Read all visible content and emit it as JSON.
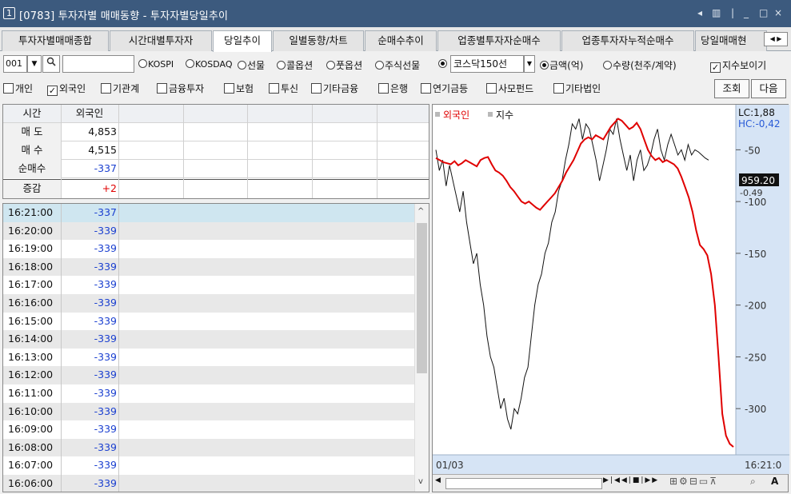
{
  "window": {
    "num": "1",
    "title": "[0783] 투자자별 매매동향 - 투자자별당일추이",
    "controls": [
      "◂",
      "▥",
      "|",
      "_",
      "□",
      "×"
    ]
  },
  "tabs": [
    "투자자별매매종합",
    "시간대별투자자",
    "당일추이",
    "일별동향/차트",
    "순매수추이",
    "업종별투자자순매수",
    "업종투자자누적순매수",
    "당일매매현"
  ],
  "active_tab": 2,
  "toolbar": {
    "code": "001",
    "search_value": "",
    "market_options": [
      "KOSPI",
      "KOSDAQ",
      "선물",
      "콜옵션",
      "풋옵션",
      "주식선물"
    ],
    "selected_market": "코스닥150선",
    "unit_options": [
      "금액(억)",
      "수량(천주/계약)"
    ],
    "selected_unit": 0,
    "index_toggle": "지수보이기",
    "index_toggle_checked": true
  },
  "investors": [
    {
      "label": "개인",
      "checked": false
    },
    {
      "label": "외국인",
      "checked": true
    },
    {
      "label": "기관계",
      "checked": false
    },
    {
      "label": "금융투자",
      "checked": false
    },
    {
      "label": "보험",
      "checked": false
    },
    {
      "label": "투신",
      "checked": false
    },
    {
      "label": "기타금융",
      "checked": false
    },
    {
      "label": "은행",
      "checked": false
    },
    {
      "label": "연기금등",
      "checked": false
    },
    {
      "label": "사모펀드",
      "checked": false
    },
    {
      "label": "기타법인",
      "checked": false
    }
  ],
  "buttons": {
    "query": "조회",
    "next": "다음"
  },
  "summary": {
    "header_time": "시간",
    "header_col": "외국인",
    "rows": [
      {
        "label": "매 도",
        "value": "4,853",
        "color": "#111111"
      },
      {
        "label": "매 수",
        "value": "4,515",
        "color": "#111111"
      },
      {
        "label": "순매수",
        "value": "-337",
        "color": "#1a3fd0"
      },
      {
        "label": "증감",
        "value": "+2",
        "color": "#e00000"
      }
    ]
  },
  "time_rows": [
    {
      "time": "16:21:00",
      "value": "-337"
    },
    {
      "time": "16:20:00",
      "value": "-339"
    },
    {
      "time": "16:19:00",
      "value": "-339"
    },
    {
      "time": "16:18:00",
      "value": "-339"
    },
    {
      "time": "16:17:00",
      "value": "-339"
    },
    {
      "time": "16:16:00",
      "value": "-339"
    },
    {
      "time": "16:15:00",
      "value": "-339"
    },
    {
      "time": "16:14:00",
      "value": "-339"
    },
    {
      "time": "16:13:00",
      "value": "-339"
    },
    {
      "time": "16:12:00",
      "value": "-339"
    },
    {
      "time": "16:11:00",
      "value": "-339"
    },
    {
      "time": "16:10:00",
      "value": "-339"
    },
    {
      "time": "16:09:00",
      "value": "-339"
    },
    {
      "time": "16:08:00",
      "value": "-339"
    },
    {
      "time": "16:07:00",
      "value": "-339"
    },
    {
      "time": "16:06:00",
      "value": "-339"
    }
  ],
  "chart_data": {
    "type": "line",
    "legend": [
      "외국인",
      "지수"
    ],
    "legend_colors": [
      "#e00000",
      "#111111"
    ],
    "y_ticks": [
      -50,
      -100,
      -150,
      -200,
      -250,
      -300
    ],
    "y_top_partial": "-50",
    "y_range": [
      -340,
      -25
    ],
    "lc_label": "LC:1,88",
    "hc_label": "HC:-0,42",
    "index_now": "959.20",
    "index_pct": "-0.49",
    "x_start": "01/03",
    "x_end": "16:21:0",
    "series": [
      {
        "name": "외국인",
        "color": "#e00000",
        "values": [
          -58,
          -60,
          -62,
          -63,
          -64,
          -61,
          -65,
          -63,
          -60,
          -62,
          -64,
          -66,
          -60,
          -58,
          -57,
          -64,
          -70,
          -72,
          -75,
          -80,
          -86,
          -90,
          -95,
          -100,
          -102,
          -100,
          -103,
          -106,
          -108,
          -104,
          -100,
          -96,
          -92,
          -86,
          -80,
          -72,
          -66,
          -60,
          -52,
          -44,
          -40,
          -38,
          -40,
          -36,
          -38,
          -40,
          -34,
          -28,
          -24,
          -20,
          -22,
          -26,
          -30,
          -28,
          -24,
          -30,
          -40,
          -50,
          -56,
          -60,
          -58,
          -62,
          -60,
          -62,
          -64,
          -68,
          -76,
          -86,
          -96,
          -110,
          -128,
          -142,
          -146,
          -152,
          -170,
          -200,
          -250,
          -305,
          -326,
          -334,
          -337
        ]
      },
      {
        "name": "지수",
        "color": "#111111",
        "values": [
          -50,
          -70,
          -60,
          -85,
          -65,
          -80,
          -95,
          -110,
          -90,
          -120,
          -140,
          -160,
          -150,
          -180,
          -200,
          -230,
          -250,
          -260,
          -280,
          -300,
          -290,
          -310,
          -320,
          -300,
          -305,
          -290,
          -270,
          -260,
          -230,
          -200,
          -180,
          -170,
          -150,
          -140,
          -120,
          -110,
          -90,
          -80,
          -60,
          -45,
          -25,
          -30,
          -20,
          -40,
          -25,
          -30,
          -45,
          -60,
          -80,
          -65,
          -50,
          -30,
          -35,
          -20,
          -40,
          -55,
          -70,
          -55,
          -80,
          -60,
          -50,
          -70,
          -65,
          -55,
          -40,
          -30,
          -50,
          -60,
          -45,
          -35,
          -45,
          -55,
          -50,
          -60,
          -45,
          -55,
          -50,
          -52,
          -55,
          -58,
          -60
        ]
      }
    ]
  }
}
